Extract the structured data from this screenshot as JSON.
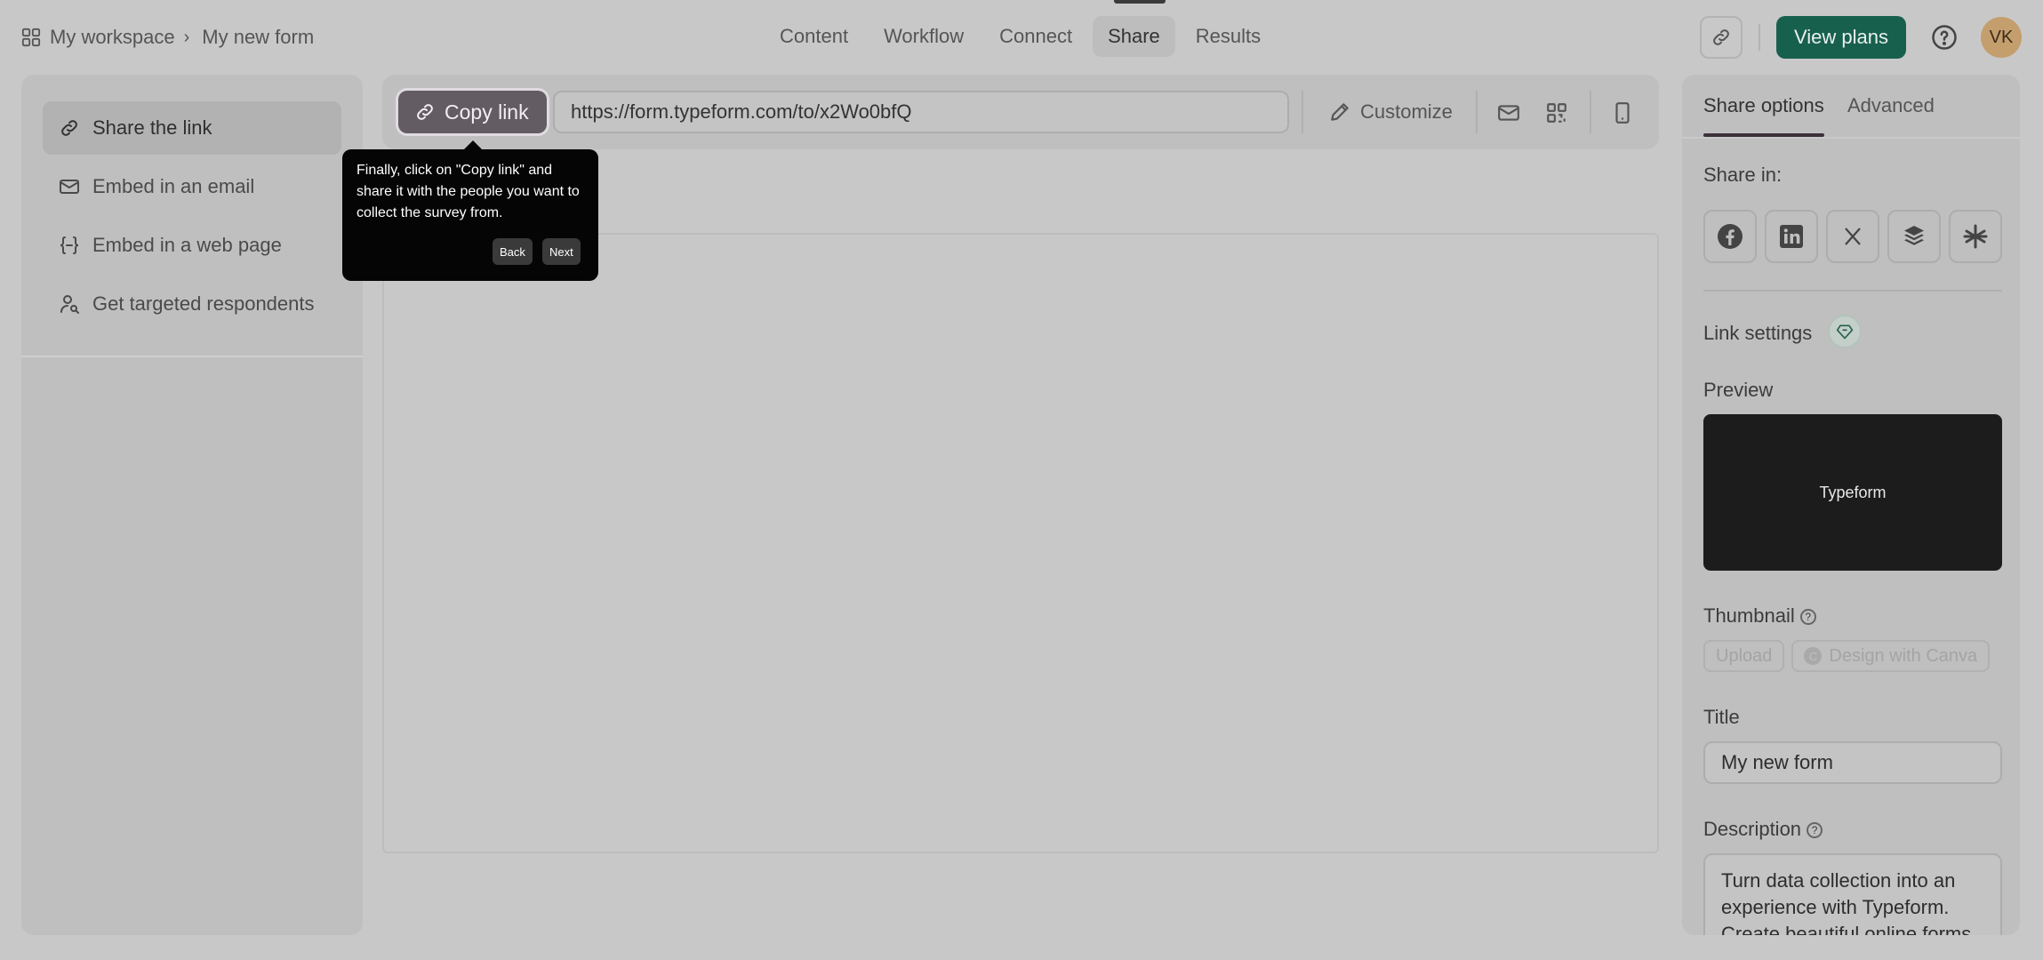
{
  "breadcrumb": {
    "workspace": "My workspace",
    "form": "My new form"
  },
  "nav": {
    "tabs": [
      "Content",
      "Workflow",
      "Connect",
      "Share",
      "Results"
    ],
    "active": "Share"
  },
  "header": {
    "view_plans": "View plans",
    "avatar_initials": "VK"
  },
  "sidebar": {
    "items": [
      {
        "label": "Share the link",
        "icon": "link-icon",
        "active": true
      },
      {
        "label": "Embed in an email",
        "icon": "mail-icon"
      },
      {
        "label": "Embed in a web page",
        "icon": "code-braces-icon"
      },
      {
        "label": "Get targeted respondents",
        "icon": "user-search-icon"
      }
    ]
  },
  "toolbar": {
    "copy_link": "Copy link",
    "url": "https://form.typeform.com/to/x2Wo0bfQ",
    "customize": "Customize"
  },
  "tooltip": {
    "text": "Finally, click on \"Copy link\" and share it with the people you want to collect the survey from.",
    "back": "Back",
    "next": "Next"
  },
  "right_panel": {
    "tabs": [
      "Share options",
      "Advanced"
    ],
    "share_in_label": "Share in:",
    "social_icons": [
      "facebook-icon",
      "linkedin-icon",
      "x-icon",
      "buffer-icon",
      "linktree-icon"
    ],
    "link_settings_label": "Link settings",
    "preview_label": "Preview",
    "preview_brand": "Typeform",
    "thumbnail_label": "Thumbnail",
    "upload": "Upload",
    "design_with_canva": "Design with Canva",
    "title_label": "Title",
    "title_value": "My new form",
    "description_label": "Description",
    "description_value": "Turn data collection into an experience with Typeform. Create beautiful online forms,"
  },
  "colors": {
    "primary": "#18604e",
    "copy_button": "#635c63",
    "avatar": "#c49e6c"
  }
}
